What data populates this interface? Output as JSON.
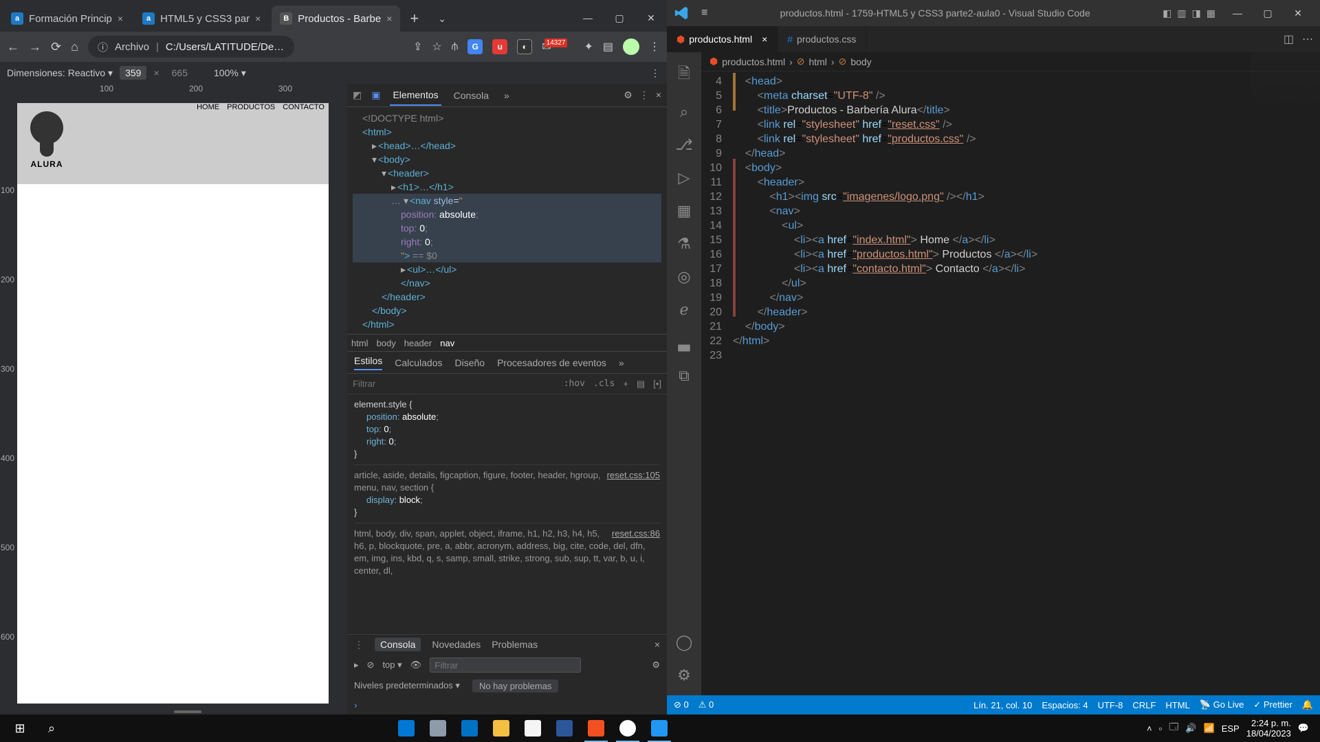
{
  "chrome": {
    "tabs": [
      {
        "favLetter": "a",
        "title": "Formación Princip"
      },
      {
        "favLetter": "a",
        "title": "HTML5 y CSS3 par"
      },
      {
        "favLetter": "B",
        "title": "Productos - Barbe"
      }
    ],
    "url_label": "Archivo",
    "url": "C:/Users/LATITUDE/Des...",
    "ext_badge": "14327",
    "dev_dim_label": "Dimensiones: Reactivo",
    "dev_w": "359",
    "dev_h": "665",
    "dev_zoom": "100%",
    "page_nav": [
      "HOME",
      "PRODUCTOS",
      "CONTACTO"
    ],
    "logo_text": "ALURA",
    "ruler_h": [
      "100",
      "200",
      "300"
    ],
    "ruler_v": [
      "100",
      "200",
      "300",
      "400",
      "500",
      "600"
    ]
  },
  "devtools": {
    "tabs": [
      "Elementos",
      "Consola"
    ],
    "dom": {
      "doctype": "<!DOCTYPE html>",
      "html_open": "<html>",
      "head": "<head>…</head>",
      "body_open": "<body>",
      "header_open": "<header>",
      "h1": "<h1>…</h1>",
      "nav_open": "<nav style=\"",
      "style_lines": [
        "position: absolute;",
        "top: 0;",
        "right: 0;"
      ],
      "nav_close_attr": "\"> == $0",
      "ul": "<ul>…</ul>",
      "nav_close": "</nav>",
      "header_close": "</header>",
      "body_close": "</body>",
      "html_close": "</html>"
    },
    "crumbs": [
      "html",
      "body",
      "header",
      "nav"
    ],
    "style_tabs": [
      "Estilos",
      "Calculados",
      "Diseño",
      "Procesadores de eventos"
    ],
    "filter": "Filtrar",
    "hov": ":hov",
    "cls": ".cls",
    "rule1": {
      "sel": "element.style {",
      "lines": [
        "position: absolute;",
        "top: 0;",
        "right: 0;"
      ]
    },
    "rule2": {
      "src": "reset.css:105",
      "sel": "article, aside, details, figcaption, figure, footer, header, hgroup, menu, nav, section {",
      "line": "display: block;"
    },
    "rule3": {
      "src": "reset.css:86",
      "sel": "html, body, div, span, applet, object, iframe, h1, h2, h3, h4, h5, h6, p, blockquote, pre, a, abbr, acronym, address, big, cite, code, del, dfn, em, img, ins, kbd, q, s, samp, small, strike, strong, sub, sup, tt, var, b, u, i, center, dl,"
    },
    "console_tabs": [
      "Consola",
      "Novedades",
      "Problemas"
    ],
    "console_top": "top",
    "console_filter": "Filtrar",
    "console_levels": "Niveles predeterminados",
    "console_probs": "No hay problemas"
  },
  "vscode": {
    "title": "productos.html - 1759-HTML5 y CSS3 parte2-aula0 - Visual Studio Code",
    "tabs": [
      {
        "label": "productos.html"
      },
      {
        "label": "productos.css"
      }
    ],
    "crumbs": [
      "productos.html",
      "html",
      "body"
    ],
    "lines": [
      {
        "n": 4,
        "html": "    <span class='b'>&lt;</span><span class='t'>head</span><span class='b'>&gt;</span>"
      },
      {
        "n": 5,
        "html": "        <span class='b'>&lt;</span><span class='t'>meta</span> <span class='a'>charset</span>=<span class='s'>\"UTF-8\"</span> <span class='b'>/&gt;</span>"
      },
      {
        "n": 6,
        "html": "        <span class='b'>&lt;</span><span class='t'>title</span><span class='b'>&gt;</span><span class='x'>Productos - Barbería Alura</span><span class='b'>&lt;/</span><span class='t'>title</span><span class='b'>&gt;</span>"
      },
      {
        "n": 7,
        "html": "        <span class='b'>&lt;</span><span class='t'>link</span> <span class='a'>rel</span>=<span class='s'>\"stylesheet\"</span> <span class='a'>href</span>=<span class='s u'>\"reset.css\"</span> <span class='b'>/&gt;</span>"
      },
      {
        "n": 8,
        "html": "        <span class='b'>&lt;</span><span class='t'>link</span> <span class='a'>rel</span>=<span class='s'>\"stylesheet\"</span> <span class='a'>href</span>=<span class='s u'>\"productos.css\"</span> <span class='b'>/&gt;</span>"
      },
      {
        "n": 9,
        "html": "    <span class='b'>&lt;/</span><span class='t'>head</span><span class='b'>&gt;</span>"
      },
      {
        "n": 10,
        "html": "    <span class='b'>&lt;</span><span class='t'>body</span><span class='b'>&gt;</span>"
      },
      {
        "n": 11,
        "html": "        <span class='b'>&lt;</span><span class='t'>header</span><span class='b'>&gt;</span>"
      },
      {
        "n": 12,
        "html": "            <span class='b'>&lt;</span><span class='t'>h1</span><span class='b'>&gt;&lt;</span><span class='t'>img</span> <span class='a'>src</span>=<span class='s u'>\"imagenes/logo.png\"</span> <span class='b'>/&gt;&lt;/</span><span class='t'>h1</span><span class='b'>&gt;</span>"
      },
      {
        "n": 13,
        "html": "            <span class='b'>&lt;</span><span class='t'>nav</span><span class='b'>&gt;</span>"
      },
      {
        "n": 14,
        "html": "                <span class='b'>&lt;</span><span class='t'>ul</span><span class='b'>&gt;</span>"
      },
      {
        "n": 15,
        "html": "                    <span class='b'>&lt;</span><span class='t'>li</span><span class='b'>&gt;&lt;</span><span class='t'>a</span> <span class='a'>href</span>=<span class='s u'>\"index.html\"</span><span class='b'>&gt;</span><span class='x'> Home </span><span class='b'>&lt;/</span><span class='t'>a</span><span class='b'>&gt;&lt;/</span><span class='t'>li</span><span class='b'>&gt;</span>"
      },
      {
        "n": 16,
        "html": "                    <span class='b'>&lt;</span><span class='t'>li</span><span class='b'>&gt;&lt;</span><span class='t'>a</span> <span class='a'>href</span>=<span class='s u'>\"productos.html\"</span><span class='b'>&gt;</span><span class='x'> Productos </span><span class='b'>&lt;/</span><span class='t'>a</span><span class='b'>&gt;&lt;/</span><span class='t'>li</span><span class='b'>&gt;</span>"
      },
      {
        "n": 17,
        "html": "                    <span class='b'>&lt;</span><span class='t'>li</span><span class='b'>&gt;&lt;</span><span class='t'>a</span> <span class='a'>href</span>=<span class='s u'>\"contacto.html\"</span><span class='b'>&gt;</span><span class='x'> Contacto </span><span class='b'>&lt;/</span><span class='t'>a</span><span class='b'>&gt;&lt;/</span><span class='t'>li</span><span class='b'>&gt;</span>"
      },
      {
        "n": 18,
        "html": "                <span class='b'>&lt;/</span><span class='t'>ul</span><span class='b'>&gt;</span>"
      },
      {
        "n": 19,
        "html": "            <span class='b'>&lt;/</span><span class='t'>nav</span><span class='b'>&gt;</span>"
      },
      {
        "n": 20,
        "html": "        <span class='b'>&lt;/</span><span class='t'>header</span><span class='b'>&gt;</span>"
      },
      {
        "n": 21,
        "html": "    <span class='b'>&lt;/</span><span class='t'>body</span><span class='b'>&gt;</span>"
      },
      {
        "n": 22,
        "html": "<span class='b'>&lt;/</span><span class='t'>html</span><span class='b'>&gt;</span>"
      },
      {
        "n": 23,
        "html": ""
      }
    ],
    "status": {
      "errors": "0",
      "warnings": "0",
      "pos": "Lín. 21, col. 10",
      "spaces": "Espacios: 4",
      "enc": "UTF-8",
      "eol": "CRLF",
      "lang": "HTML",
      "golive": "Go Live",
      "prettier": "Prettier"
    }
  },
  "taskbar": {
    "lang": "ESP",
    "time": "2:24 p. m.",
    "date": "18/04/2023"
  }
}
